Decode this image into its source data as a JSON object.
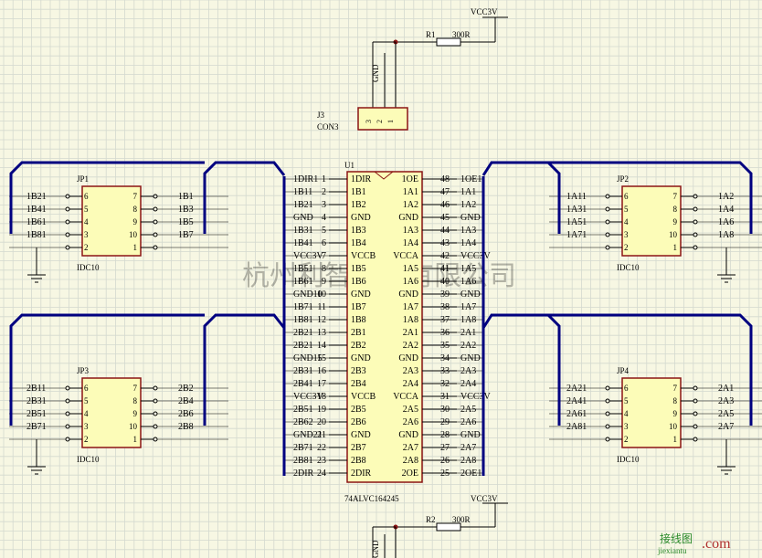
{
  "colors": {
    "background": "#f7f7e3",
    "grid": "#d4d9cf",
    "wire": "#000080",
    "part_fill": "#fcfcb8",
    "part_stroke": "#8b1414",
    "label": "#000080",
    "junction": "#8b1414"
  },
  "power": {
    "top": {
      "net": "VCC3V",
      "res_ref": "R1",
      "res_val": "300R",
      "gnd": "GND"
    },
    "bottom": {
      "net": "VCC3V",
      "res_ref": "R2",
      "res_val": "300R",
      "gnd": "GND"
    }
  },
  "j3": {
    "ref": "J3",
    "value": "CON3",
    "pins": [
      "3",
      "2",
      "1"
    ]
  },
  "u1": {
    "ref": "U1",
    "part": "74ALVC164245",
    "left_nets": [
      "1DIR1",
      "1B11",
      "1B21",
      "GND",
      "1B31",
      "1B41",
      "VCC3V",
      "1B51",
      "1B61",
      "GND10",
      "1B71",
      "1B81",
      "2B21",
      "2B21",
      "GND15",
      "2B31",
      "2B41",
      "VCC3V",
      "2B51",
      "2B62",
      "GND21",
      "2B71",
      "2B81",
      "2DIR"
    ],
    "left_nums": [
      "1",
      "2",
      "3",
      "4",
      "5",
      "6",
      "7",
      "8",
      "9",
      "10",
      "11",
      "12",
      "13",
      "14",
      "15",
      "16",
      "17",
      "18",
      "19",
      "20",
      "21",
      "22",
      "23",
      "24"
    ],
    "left_names": [
      "1DIR",
      "1B1",
      "1B2",
      "GND",
      "1B3",
      "1B4",
      "VCCB",
      "1B5",
      "1B6",
      "GND",
      "1B7",
      "1B8",
      "2B1",
      "2B2",
      "GND",
      "2B3",
      "2B4",
      "VCCB",
      "2B5",
      "2B6",
      "GND",
      "2B7",
      "2B8",
      "2DIR"
    ],
    "right_names": [
      "1OE",
      "1A1",
      "1A2",
      "GND",
      "1A3",
      "1A4",
      "VCCA",
      "1A5",
      "1A6",
      "GND",
      "1A7",
      "1A8",
      "2A1",
      "2A2",
      "GND",
      "2A3",
      "2A4",
      "VCCA",
      "2A5",
      "2A6",
      "GND",
      "2A7",
      "2A8",
      "2OE"
    ],
    "right_nums": [
      "48",
      "47",
      "46",
      "45",
      "44",
      "43",
      "42",
      "41",
      "40",
      "39",
      "38",
      "37",
      "36",
      "35",
      "34",
      "33",
      "32",
      "31",
      "30",
      "29",
      "28",
      "27",
      "26",
      "25"
    ],
    "right_nets": [
      "1OE1",
      "1A1",
      "1A2",
      "GND",
      "1A3",
      "1A4",
      "VCC3V",
      "1A5",
      "1A6",
      "GND",
      "1A7",
      "1A8",
      "2A1",
      "2A2",
      "GND",
      "2A3",
      "2A4",
      "VCC3V",
      "2A5",
      "2A6",
      "GND",
      "2A7",
      "2A8",
      "2OE1"
    ]
  },
  "headers": [
    {
      "ref": "JP1",
      "value": "IDC10",
      "left_nets": [
        "1B21",
        "1B41",
        "1B61",
        "1B81"
      ],
      "right_nets": [
        "1B1",
        "1B3",
        "1B5",
        "1B7"
      ]
    },
    {
      "ref": "JP2",
      "value": "IDC10",
      "left_nets": [
        "1A11",
        "1A31",
        "1A51",
        "1A71"
      ],
      "right_nets": [
        "1A2",
        "1A4",
        "1A6",
        "1A8"
      ]
    },
    {
      "ref": "JP3",
      "value": "IDC10",
      "left_nets": [
        "2B11",
        "2B31",
        "2B51",
        "2B71"
      ],
      "right_nets": [
        "2B2",
        "2B4",
        "2B6",
        "2B8"
      ]
    },
    {
      "ref": "JP4",
      "value": "IDC10",
      "left_nets": [
        "2A21",
        "2A41",
        "2A61",
        "2A81"
      ],
      "right_nets": [
        "2A1",
        "2A3",
        "2A5",
        "2A7"
      ]
    }
  ],
  "idc_pins": {
    "left": [
      "6",
      "5",
      "4",
      "3",
      "2"
    ],
    "right": [
      "7",
      "8",
      "9",
      "10",
      "1"
    ]
  },
  "watermark": "杭州利智科技有限公司",
  "logo": {
    "cn": "接线图",
    "domain": "jiexiantu",
    ".com": ".com"
  }
}
